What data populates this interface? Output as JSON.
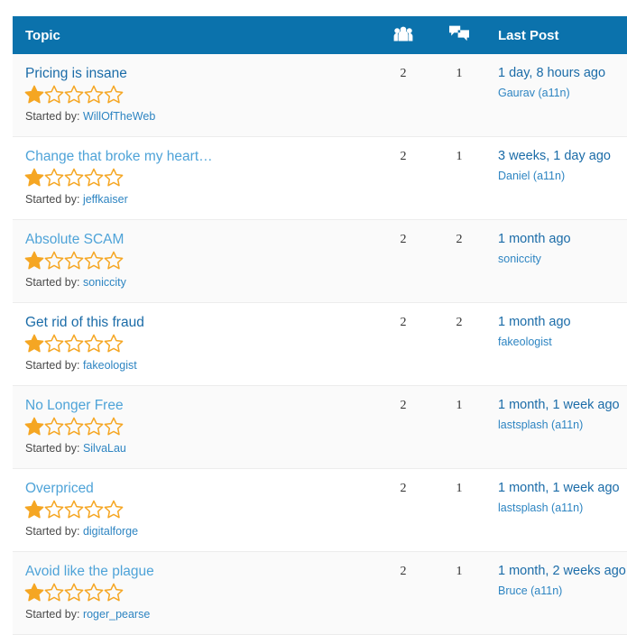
{
  "table": {
    "header": {
      "topic_label": "Topic",
      "voices_icon": "users-group-icon",
      "replies_icon": "speech-bubbles-icon",
      "last_post_label": "Last Post"
    },
    "started_by_prefix": "Started by:",
    "rating_max": 5,
    "colors": {
      "header_bg": "#0b72ac",
      "star_filled": "#f5a623",
      "star_empty_stroke": "#f5a623",
      "link_dark": "#1b6ca8",
      "link_light": "#4ea3d8",
      "row_alt_bg": "#fafafa",
      "row_border": "#ececec"
    },
    "rows": [
      {
        "title": "Pricing is insane",
        "title_style": "dark",
        "rating": 1,
        "author": "WillOfTheWeb",
        "voices": "2",
        "replies": "1",
        "last_post_time": "1 day, 8 hours ago",
        "last_post_user": "Gaurav (a11n)"
      },
      {
        "title": "Change that broke my heart…",
        "title_style": "light",
        "rating": 1,
        "author": "jeffkaiser",
        "voices": "2",
        "replies": "1",
        "last_post_time": "3 weeks, 1 day ago",
        "last_post_user": "Daniel (a11n)"
      },
      {
        "title": "Absolute SCAM",
        "title_style": "light",
        "rating": 1,
        "author": "soniccity",
        "voices": "2",
        "replies": "2",
        "last_post_time": "1 month ago",
        "last_post_user": "soniccity"
      },
      {
        "title": "Get rid of this fraud",
        "title_style": "dark",
        "rating": 1,
        "author": "fakeologist",
        "voices": "2",
        "replies": "2",
        "last_post_time": "1 month ago",
        "last_post_user": "fakeologist"
      },
      {
        "title": "No Longer Free",
        "title_style": "light",
        "rating": 1,
        "author": "SilvaLau",
        "voices": "2",
        "replies": "1",
        "last_post_time": "1 month, 1 week ago",
        "last_post_user": "lastsplash (a11n)"
      },
      {
        "title": "Overpriced",
        "title_style": "light",
        "rating": 1,
        "author": "digitalforge",
        "voices": "2",
        "replies": "1",
        "last_post_time": "1 month, 1 week ago",
        "last_post_user": "lastsplash (a11n)"
      },
      {
        "title": "Avoid like the plague",
        "title_style": "light",
        "rating": 1,
        "author": "roger_pearse",
        "voices": "2",
        "replies": "1",
        "last_post_time": "1 month, 2 weeks ago",
        "last_post_user": "Bruce (a11n)"
      }
    ]
  }
}
